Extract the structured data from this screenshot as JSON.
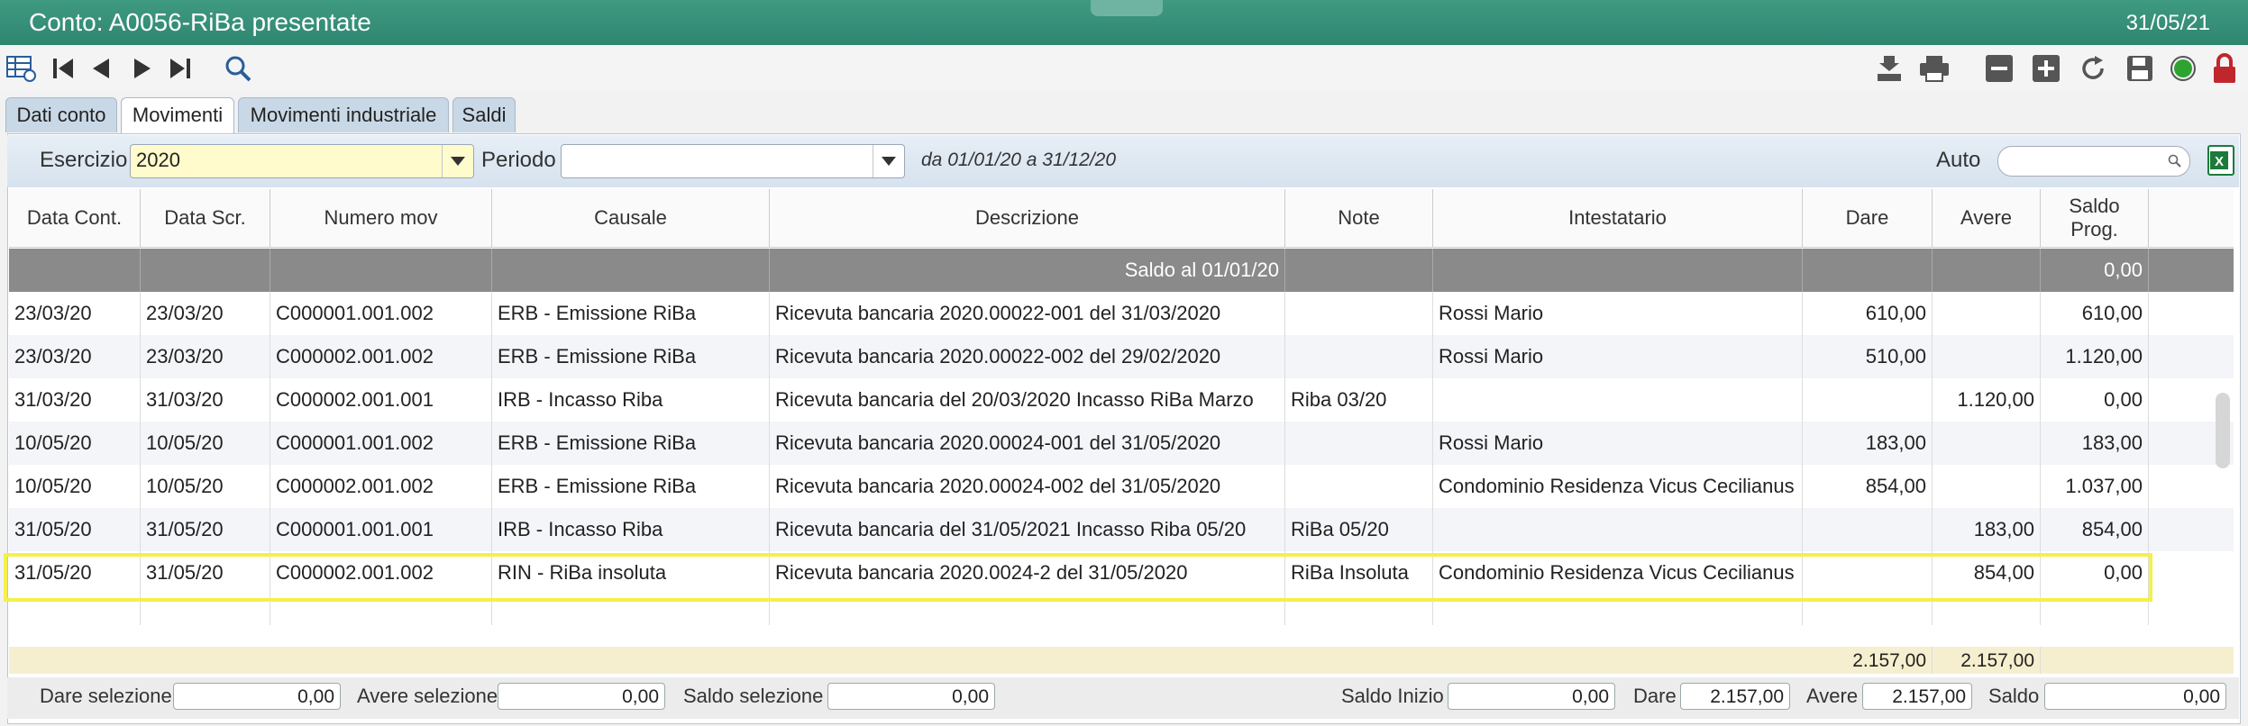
{
  "window": {
    "title": "Conto: A0056-RiBa presentate",
    "date": "31/05/21"
  },
  "toolbar": {
    "left": [
      "table-settings-icon",
      "first-record-icon",
      "prev-record-icon",
      "next-record-icon",
      "last-record-icon",
      "search-icon"
    ],
    "right": [
      "archive-icon",
      "print-icon",
      "remove-icon",
      "add-icon",
      "refresh-icon",
      "save-icon",
      "status-icon",
      "lock-icon"
    ]
  },
  "tabs": [
    "Dati conto",
    "Movimenti",
    "Movimenti industriale",
    "Saldi"
  ],
  "filter": {
    "esercizio_label": "Esercizio",
    "esercizio_value": "2020",
    "periodo_label": "Periodo",
    "periodo_value": "",
    "range": "da 01/01/20 a 31/12/20",
    "auto_label": "Auto"
  },
  "table": {
    "headers": [
      "Data Cont.",
      "Data Scr.",
      "Numero mov",
      "Causale",
      "Descrizione",
      "Note",
      "Intestatario",
      "Dare",
      "Avere",
      "Saldo Prog."
    ],
    "saldo_row": {
      "label": "Saldo al 01/01/20",
      "saldo": "0,00"
    },
    "rows": [
      [
        "23/03/20",
        "23/03/20",
        "C000001.001.002",
        "ERB - Emissione RiBa",
        "Ricevuta bancaria 2020.00022-001 del 31/03/2020",
        "",
        "Rossi Mario",
        "610,00",
        "",
        "610,00"
      ],
      [
        "23/03/20",
        "23/03/20",
        "C000002.001.002",
        "ERB - Emissione RiBa",
        "Ricevuta bancaria 2020.00022-002 del 29/02/2020",
        "",
        "Rossi Mario",
        "510,00",
        "",
        "1.120,00"
      ],
      [
        "31/03/20",
        "31/03/20",
        "C000002.001.001",
        "IRB - Incasso Riba",
        "Ricevuta bancaria del 20/03/2020 Incasso RiBa Marzo",
        "Riba 03/20",
        "",
        "",
        "1.120,00",
        "0,00"
      ],
      [
        "10/05/20",
        "10/05/20",
        "C000001.001.002",
        "ERB - Emissione RiBa",
        "Ricevuta bancaria 2020.00024-001 del 31/05/2020",
        "",
        "Rossi Mario",
        "183,00",
        "",
        "183,00"
      ],
      [
        "10/05/20",
        "10/05/20",
        "C000002.001.002",
        "ERB - Emissione RiBa",
        "Ricevuta bancaria 2020.00024-002 del 31/05/2020",
        "",
        "Condominio Residenza Vicus Cecilianus",
        "854,00",
        "",
        "1.037,00"
      ],
      [
        "31/05/20",
        "31/05/20",
        "C000001.001.001",
        "IRB - Incasso Riba",
        "Ricevuta bancaria del 31/05/2021 Incasso Riba 05/20",
        "RiBa 05/20",
        "",
        "",
        "183,00",
        "854,00"
      ],
      [
        "31/05/20",
        "31/05/20",
        "C000002.001.002",
        "RIN - RiBa insoluta",
        "Ricevuta bancaria 2020.0024-2 del 31/05/2020",
        "RiBa Insoluta",
        "Condominio Residenza Vicus Cecilianus",
        "",
        "854,00",
        "0,00"
      ]
    ],
    "totals": {
      "dare": "2.157,00",
      "avere": "2.157,00"
    }
  },
  "footer": {
    "dare_sel_label": "Dare selezione",
    "dare_sel": "0,00",
    "avere_sel_label": "Avere selezione",
    "avere_sel": "0,00",
    "saldo_sel_label": "Saldo selezione",
    "saldo_sel": "0,00",
    "saldo_inizio_label": "Saldo Inizio",
    "saldo_inizio": "0,00",
    "dare_label": "Dare",
    "dare": "2.157,00",
    "avere_label": "Avere",
    "avere": "2.157,00",
    "saldo_label": "Saldo",
    "saldo": "0,00"
  },
  "colors": {
    "titlebar": "#3f9a82",
    "tab": "#c9d8e6",
    "highlight": "#f5f04a",
    "saldo_row": "#8a8a8a",
    "totals_row": "#f6efcf"
  }
}
